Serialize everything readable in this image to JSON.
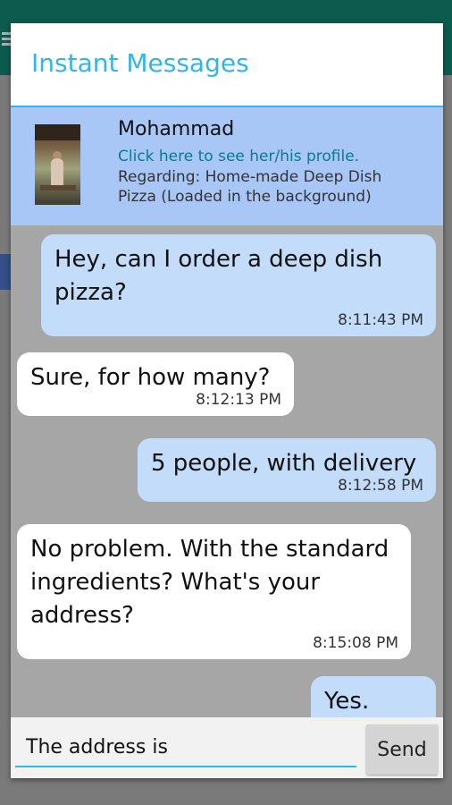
{
  "dialog": {
    "title": "Instant Messages"
  },
  "contact": {
    "name": "Mohammad",
    "profile_link": "Click here to see her/his profile.",
    "regarding": "Regarding: Home-made Deep Dish Pizza (Loaded in the background)"
  },
  "messages": [
    {
      "direction": "outgoing",
      "text": "Hey, can I order a deep dish pizza?",
      "time": "8:11:43 PM"
    },
    {
      "direction": "incoming",
      "text": "Sure, for how many?",
      "time": "8:12:13 PM"
    },
    {
      "direction": "outgoing",
      "text": "5 people, with delivery",
      "time": "8:12:58 PM"
    },
    {
      "direction": "incoming",
      "text": "No problem.  With the standard ingredients?  What's your address?",
      "time": "8:15:08 PM"
    },
    {
      "direction": "outgoing",
      "text": "Yes.",
      "time": ""
    }
  ],
  "composer": {
    "input_value": "The address is",
    "send_label": "Send"
  },
  "colors": {
    "accent": "#33b5e5",
    "outgoing_bubble": "#c2dcfa",
    "incoming_bubble": "#ffffff",
    "contact_banner": "#a8c6f6",
    "link": "#0a7a8c"
  }
}
